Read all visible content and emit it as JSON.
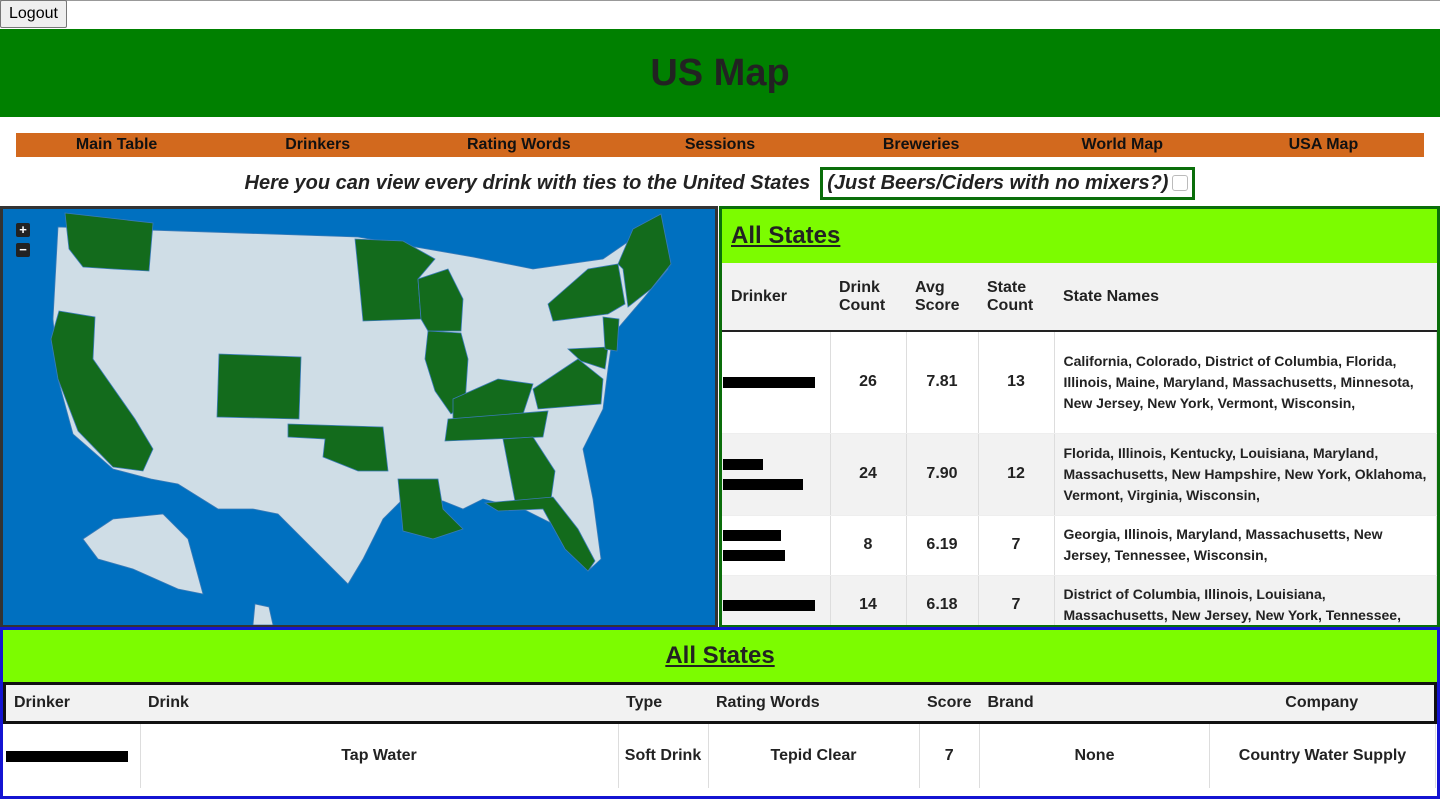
{
  "logout_label": "Logout",
  "page_title": "US Map",
  "nav": [
    "Main Table",
    "Drinkers",
    "Rating Words",
    "Sessions",
    "Breweries",
    "World Map",
    "USA Map"
  ],
  "intro_text": "Here you can view every drink with ties to the United States",
  "filter_label": "(Just Beers/Ciders with no mixers?)",
  "filter_checked": false,
  "colors": {
    "header": "#008000",
    "nav": "#d2691e",
    "panel_title": "#7cfc00",
    "ocean": "#0070c0",
    "state_selected": "#136b1c",
    "state_default": "#cfdde6"
  },
  "map_controls": {
    "zoom_in": "+",
    "zoom_out": "−"
  },
  "states_panel": {
    "title": "All States",
    "columns": [
      "Drinker",
      "Drink Count",
      "Avg Score",
      "State Count",
      "State Names"
    ],
    "rows": [
      {
        "drink_count": "26",
        "avg_score": "7.81",
        "state_count": "13",
        "state_names": "California, Colorado, District of Columbia, Florida, Illinois, Maine, Maryland, Massachusetts, Minnesota, New Jersey, New York, Vermont, Wisconsin,"
      },
      {
        "drink_count": "24",
        "avg_score": "7.90",
        "state_count": "12",
        "state_names": "Florida, Illinois, Kentucky, Louisiana, Maryland, Massachusetts, New Hampshire, New York, Oklahoma, Vermont, Virginia, Wisconsin,"
      },
      {
        "drink_count": "8",
        "avg_score": "6.19",
        "state_count": "7",
        "state_names": "Georgia, Illinois, Maryland, Massachusetts, New Jersey, Tennessee, Wisconsin,"
      },
      {
        "drink_count": "14",
        "avg_score": "6.18",
        "state_count": "7",
        "state_names": "District of Columbia, Illinois, Louisiana, Massachusetts, New Jersey, New York, Tennessee,"
      }
    ]
  },
  "drinks_panel": {
    "title": "All States",
    "columns": [
      "Drinker",
      "Drink",
      "Type",
      "Rating Words",
      "Score",
      "Brand",
      "Company"
    ],
    "rows": [
      {
        "drink": "Tap Water",
        "type": "Soft Drink",
        "rating_words": "Tepid Clear",
        "score": "7",
        "brand": "None",
        "company": "Country Water Supply"
      }
    ]
  }
}
